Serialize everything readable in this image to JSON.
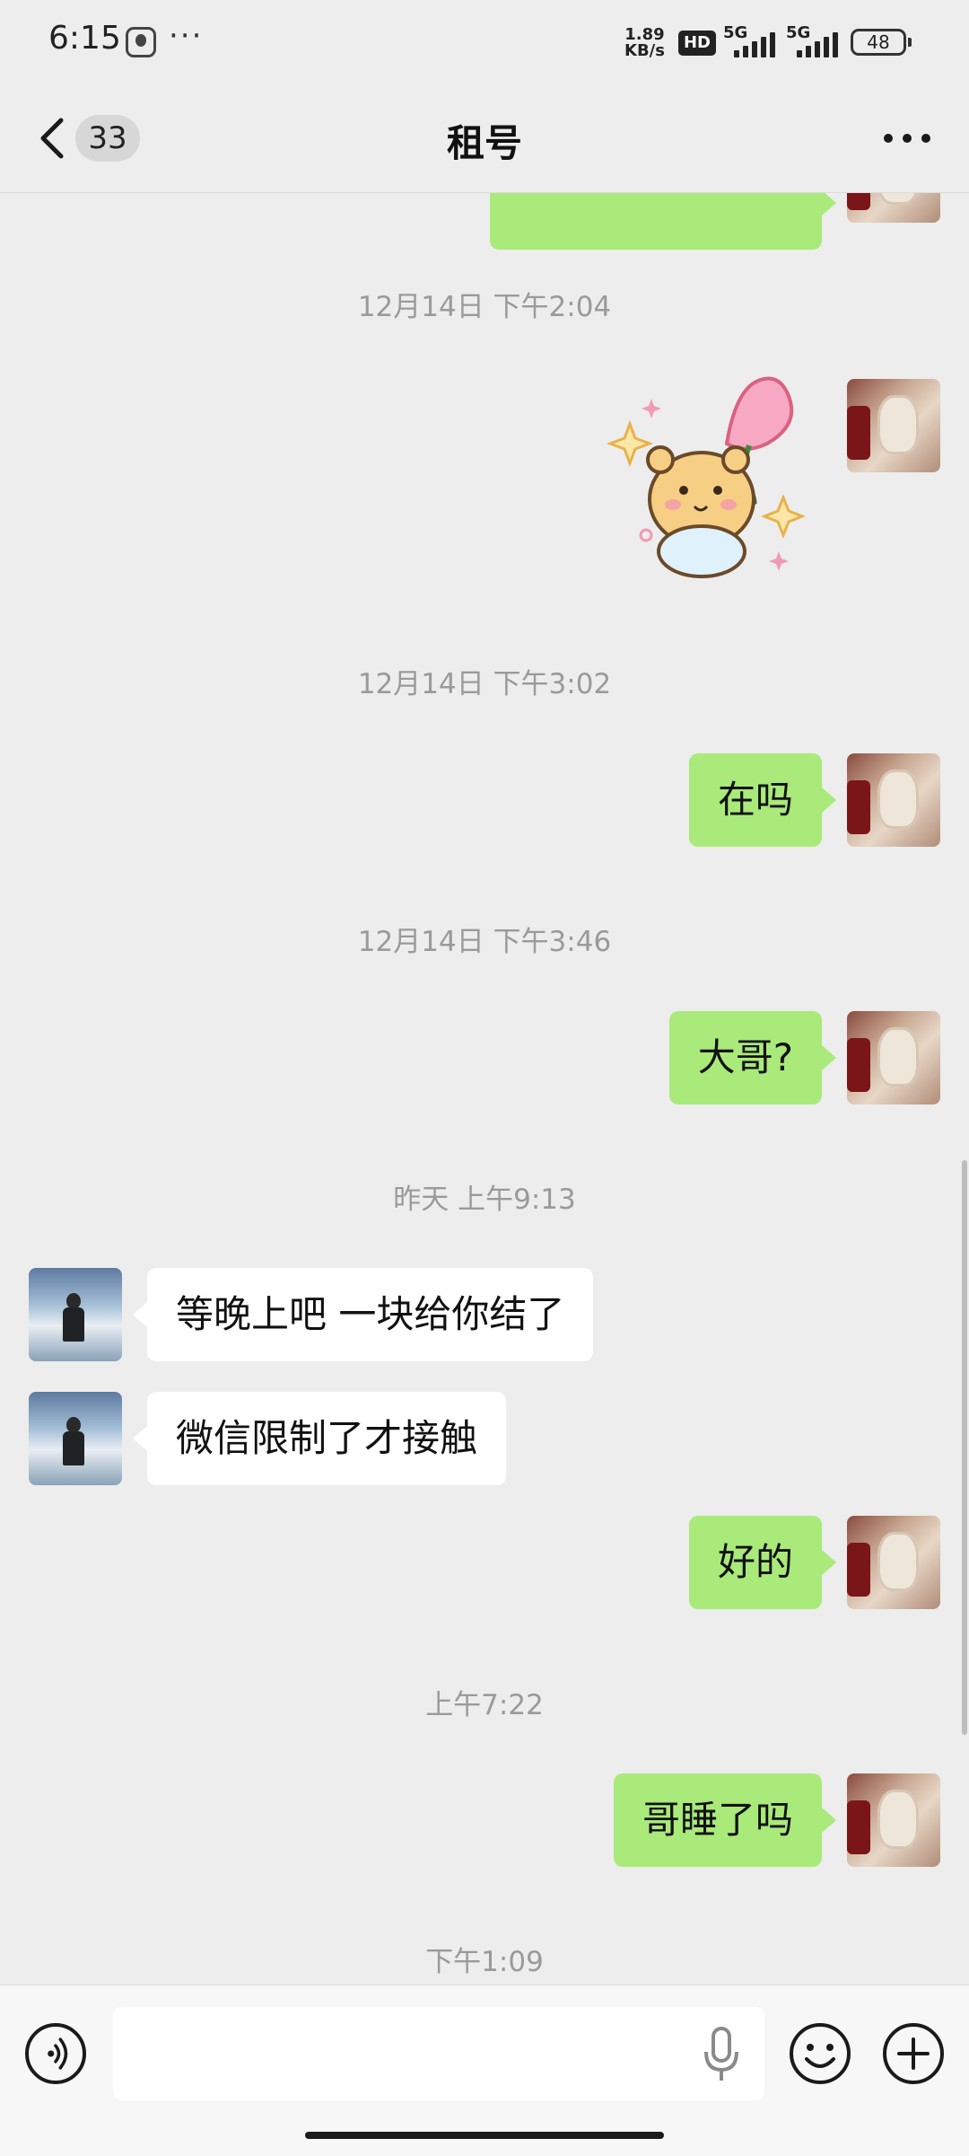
{
  "status_bar": {
    "time": "6:15",
    "dots": "···",
    "speed_value": "1.89",
    "speed_unit": "KB/s",
    "hd_label": "HD",
    "net1": "5G",
    "net2": "5G",
    "battery": "48"
  },
  "header": {
    "unread_count": "33",
    "title": "租号",
    "back_icon": "chevron-left-icon",
    "more_icon": "more-horizontal-icon"
  },
  "messages": {
    "ts1": "12月14日 下午2:04",
    "ts2": "12月14日 下午3:02",
    "m_zaima": "在吗",
    "ts3": "12月14日 下午3:46",
    "m_dage": "大哥?",
    "ts4": "昨天 上午9:13",
    "m_wait": "等晚上吧 一块给你结了",
    "m_wechat": "微信限制了才接触",
    "m_ok": "好的",
    "ts5": "上午7:22",
    "m_sleep": "哥睡了吗",
    "ts6": "下午1:09"
  },
  "input_bar": {
    "text_value": "",
    "voice_icon": "voice-icon",
    "mic_icon": "microphone-icon",
    "emoji_icon": "emoji-icon",
    "plus_icon": "plus-circle-icon"
  },
  "colors": {
    "background": "#ededed",
    "my_bubble": "#a9ea7a",
    "other_bubble": "#ffffff",
    "timestamp": "#9a9a9a"
  }
}
